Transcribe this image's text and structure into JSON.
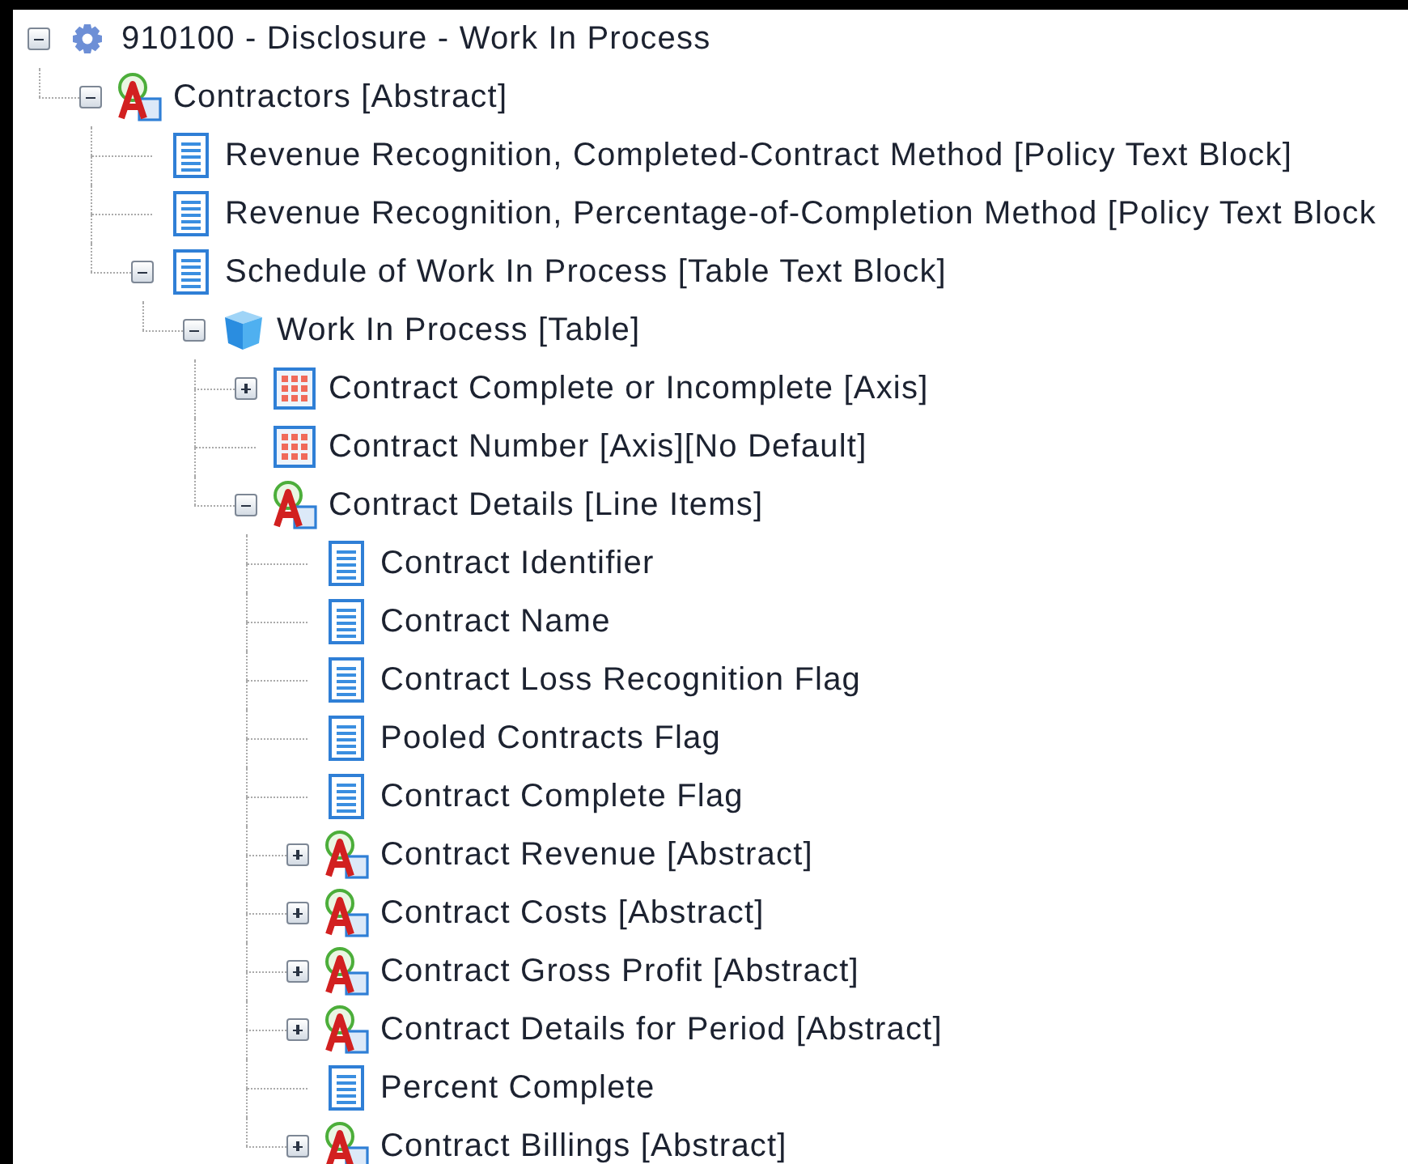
{
  "tree": {
    "kind": "root",
    "label": "910100 - Disclosure - Work In Process",
    "expanded": true,
    "children": [
      {
        "kind": "abstract",
        "label": "Contractors [Abstract]",
        "expanded": true,
        "children": [
          {
            "kind": "textblock",
            "label": "Revenue Recognition, Completed-Contract Method [Policy Text Block]"
          },
          {
            "kind": "textblock",
            "label": "Revenue Recognition, Percentage-of-Completion Method [Policy Text Block"
          },
          {
            "kind": "textblock",
            "label": "Schedule of Work In Process [Table Text Block]",
            "expanded": true,
            "children": [
              {
                "kind": "table",
                "label": "Work In Process [Table]",
                "expanded": true,
                "children": [
                  {
                    "kind": "axis",
                    "label": "Contract Complete or Incomplete [Axis]",
                    "expanded": false
                  },
                  {
                    "kind": "axis",
                    "label": "Contract Number [Axis][No Default]"
                  },
                  {
                    "kind": "abstract",
                    "label": "Contract Details [Line Items]",
                    "expanded": true,
                    "children": [
                      {
                        "kind": "textblock",
                        "label": "Contract Identifier"
                      },
                      {
                        "kind": "textblock",
                        "label": "Contract Name"
                      },
                      {
                        "kind": "textblock",
                        "label": "Contract Loss Recognition Flag"
                      },
                      {
                        "kind": "textblock",
                        "label": "Pooled Contracts Flag"
                      },
                      {
                        "kind": "textblock",
                        "label": "Contract Complete Flag"
                      },
                      {
                        "kind": "abstract",
                        "label": "Contract Revenue [Abstract]",
                        "expanded": false
                      },
                      {
                        "kind": "abstract",
                        "label": "Contract Costs [Abstract]",
                        "expanded": false
                      },
                      {
                        "kind": "abstract",
                        "label": "Contract Gross Profit [Abstract]",
                        "expanded": false
                      },
                      {
                        "kind": "abstract",
                        "label": "Contract Details for Period [Abstract]",
                        "expanded": false
                      },
                      {
                        "kind": "textblock",
                        "label": "Percent Complete"
                      },
                      {
                        "kind": "abstract",
                        "label": "Contract Billings [Abstract]",
                        "expanded": false
                      }
                    ]
                  }
                ]
              }
            ]
          }
        ]
      }
    ]
  }
}
